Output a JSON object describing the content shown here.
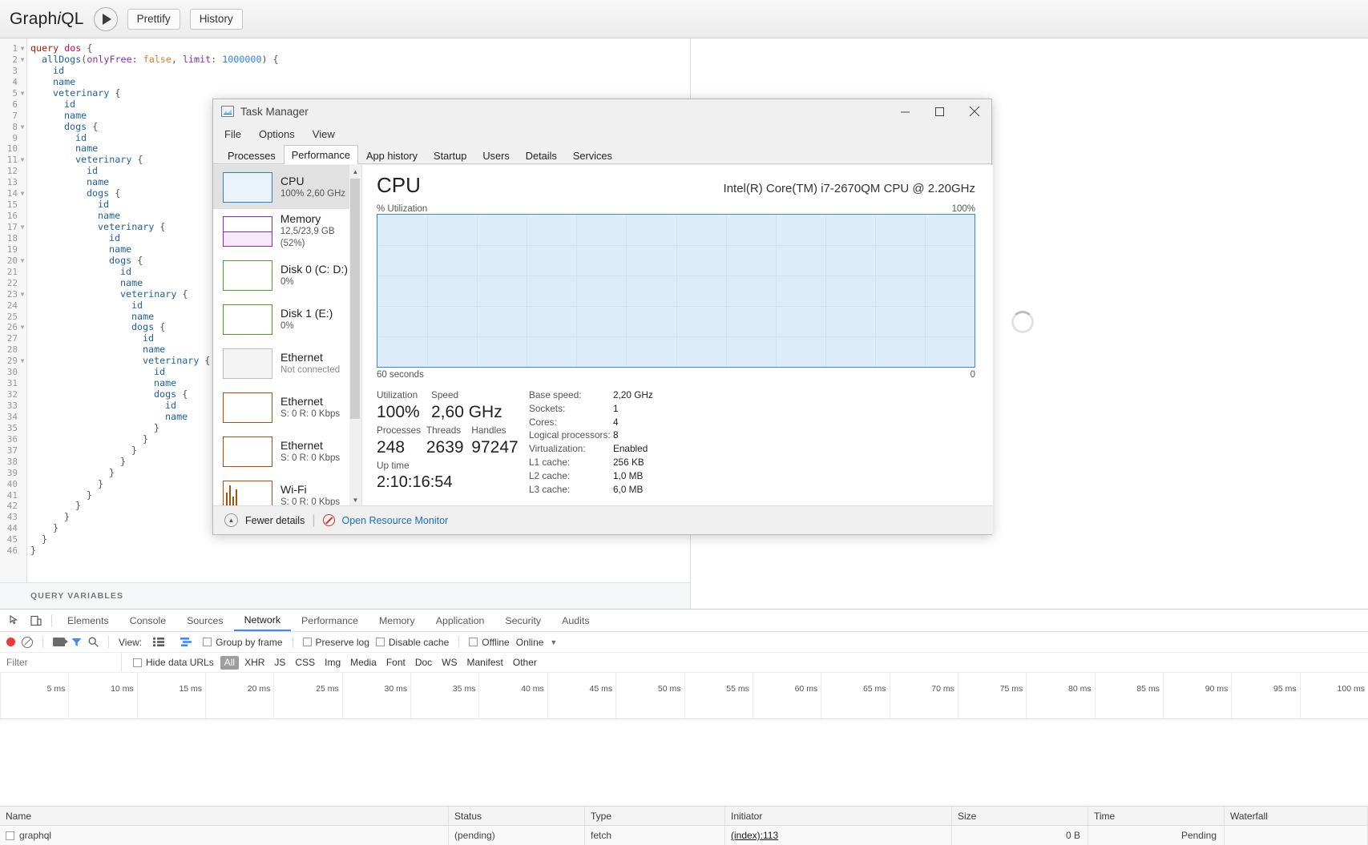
{
  "graphiql": {
    "logo_pre": "Graph",
    "logo_i": "i",
    "logo_post": "QL",
    "execute_label": "▶",
    "prettify_label": "Prettify",
    "history_label": "History",
    "query_variables_label": "QUERY VARIABLES",
    "code_lines": [
      {
        "n": 1,
        "fold": true,
        "indent": 0,
        "tokens": [
          {
            "t": "query ",
            "c": "k-key"
          },
          {
            "t": "dos",
            "c": "k-def"
          },
          {
            "t": " {",
            "c": "k-punc"
          }
        ]
      },
      {
        "n": 2,
        "fold": true,
        "indent": 1,
        "tokens": [
          {
            "t": "allDogs",
            "c": "k-field"
          },
          {
            "t": "(",
            "c": "k-punc"
          },
          {
            "t": "onlyFree",
            "c": "k-arg"
          },
          {
            "t": ": ",
            "c": "k-punc"
          },
          {
            "t": "false",
            "c": "k-bool"
          },
          {
            "t": ", ",
            "c": "k-punc"
          },
          {
            "t": "limit",
            "c": "k-arg"
          },
          {
            "t": ": ",
            "c": "k-punc"
          },
          {
            "t": "1000000",
            "c": "k-num"
          },
          {
            "t": ") {",
            "c": "k-punc"
          }
        ]
      },
      {
        "n": 3,
        "fold": false,
        "indent": 2,
        "tokens": [
          {
            "t": "id",
            "c": "k-field"
          }
        ]
      },
      {
        "n": 4,
        "fold": false,
        "indent": 2,
        "tokens": [
          {
            "t": "name",
            "c": "k-field"
          }
        ]
      },
      {
        "n": 5,
        "fold": true,
        "indent": 2,
        "tokens": [
          {
            "t": "veterinary",
            "c": "k-field"
          },
          {
            "t": " {",
            "c": "k-punc"
          }
        ]
      },
      {
        "n": 6,
        "fold": false,
        "indent": 3,
        "tokens": [
          {
            "t": "id",
            "c": "k-field"
          }
        ]
      },
      {
        "n": 7,
        "fold": false,
        "indent": 3,
        "tokens": [
          {
            "t": "name",
            "c": "k-field"
          }
        ]
      },
      {
        "n": 8,
        "fold": true,
        "indent": 3,
        "tokens": [
          {
            "t": "dogs",
            "c": "k-field"
          },
          {
            "t": " {",
            "c": "k-punc"
          }
        ]
      },
      {
        "n": 9,
        "fold": false,
        "indent": 4,
        "tokens": [
          {
            "t": "id",
            "c": "k-field"
          }
        ]
      },
      {
        "n": 10,
        "fold": false,
        "indent": 4,
        "tokens": [
          {
            "t": "name",
            "c": "k-field"
          }
        ]
      },
      {
        "n": 11,
        "fold": true,
        "indent": 4,
        "tokens": [
          {
            "t": "veterinary",
            "c": "k-field"
          },
          {
            "t": " {",
            "c": "k-punc"
          }
        ]
      },
      {
        "n": 12,
        "fold": false,
        "indent": 5,
        "tokens": [
          {
            "t": "id",
            "c": "k-field"
          }
        ]
      },
      {
        "n": 13,
        "fold": false,
        "indent": 5,
        "tokens": [
          {
            "t": "name",
            "c": "k-field"
          }
        ]
      },
      {
        "n": 14,
        "fold": true,
        "indent": 5,
        "tokens": [
          {
            "t": "dogs",
            "c": "k-field"
          },
          {
            "t": " {",
            "c": "k-punc"
          }
        ]
      },
      {
        "n": 15,
        "fold": false,
        "indent": 6,
        "tokens": [
          {
            "t": "id",
            "c": "k-field"
          }
        ]
      },
      {
        "n": 16,
        "fold": false,
        "indent": 6,
        "tokens": [
          {
            "t": "name",
            "c": "k-field"
          }
        ]
      },
      {
        "n": 17,
        "fold": true,
        "indent": 6,
        "tokens": [
          {
            "t": "veterinary",
            "c": "k-field"
          },
          {
            "t": " {",
            "c": "k-punc"
          }
        ]
      },
      {
        "n": 18,
        "fold": false,
        "indent": 7,
        "tokens": [
          {
            "t": "id",
            "c": "k-field"
          }
        ]
      },
      {
        "n": 19,
        "fold": false,
        "indent": 7,
        "tokens": [
          {
            "t": "name",
            "c": "k-field"
          }
        ]
      },
      {
        "n": 20,
        "fold": true,
        "indent": 7,
        "tokens": [
          {
            "t": "dogs",
            "c": "k-field"
          },
          {
            "t": " {",
            "c": "k-punc"
          }
        ]
      },
      {
        "n": 21,
        "fold": false,
        "indent": 8,
        "tokens": [
          {
            "t": "id",
            "c": "k-field"
          }
        ]
      },
      {
        "n": 22,
        "fold": false,
        "indent": 8,
        "tokens": [
          {
            "t": "name",
            "c": "k-field"
          }
        ]
      },
      {
        "n": 23,
        "fold": true,
        "indent": 8,
        "tokens": [
          {
            "t": "veterinary",
            "c": "k-field"
          },
          {
            "t": " {",
            "c": "k-punc"
          }
        ]
      },
      {
        "n": 24,
        "fold": false,
        "indent": 9,
        "tokens": [
          {
            "t": "id",
            "c": "k-field"
          }
        ]
      },
      {
        "n": 25,
        "fold": false,
        "indent": 9,
        "tokens": [
          {
            "t": "name",
            "c": "k-field"
          }
        ]
      },
      {
        "n": 26,
        "fold": true,
        "indent": 9,
        "tokens": [
          {
            "t": "dogs",
            "c": "k-field"
          },
          {
            "t": " {",
            "c": "k-punc"
          }
        ]
      },
      {
        "n": 27,
        "fold": false,
        "indent": 10,
        "tokens": [
          {
            "t": "id",
            "c": "k-field"
          }
        ]
      },
      {
        "n": 28,
        "fold": false,
        "indent": 10,
        "tokens": [
          {
            "t": "name",
            "c": "k-field"
          }
        ]
      },
      {
        "n": 29,
        "fold": true,
        "indent": 10,
        "tokens": [
          {
            "t": "veterinary",
            "c": "k-field"
          },
          {
            "t": " {",
            "c": "k-punc"
          }
        ]
      },
      {
        "n": 30,
        "fold": false,
        "indent": 11,
        "tokens": [
          {
            "t": "id",
            "c": "k-field"
          }
        ]
      },
      {
        "n": 31,
        "fold": false,
        "indent": 11,
        "tokens": [
          {
            "t": "name",
            "c": "k-field"
          }
        ]
      },
      {
        "n": 32,
        "fold": false,
        "indent": 11,
        "tokens": [
          {
            "t": "dogs",
            "c": "k-field"
          },
          {
            "t": " {",
            "c": "k-punc"
          }
        ]
      },
      {
        "n": 33,
        "fold": false,
        "indent": 12,
        "tokens": [
          {
            "t": "id",
            "c": "k-field"
          }
        ]
      },
      {
        "n": 34,
        "fold": false,
        "indent": 12,
        "tokens": [
          {
            "t": "name",
            "c": "k-field"
          }
        ]
      },
      {
        "n": 35,
        "fold": false,
        "indent": 11,
        "tokens": [
          {
            "t": "}",
            "c": "k-punc"
          }
        ]
      },
      {
        "n": 36,
        "fold": false,
        "indent": 10,
        "tokens": [
          {
            "t": "}",
            "c": "k-punc"
          }
        ]
      },
      {
        "n": 37,
        "fold": false,
        "indent": 9,
        "tokens": [
          {
            "t": "}",
            "c": "k-punc"
          }
        ]
      },
      {
        "n": 38,
        "fold": false,
        "indent": 8,
        "tokens": [
          {
            "t": "}",
            "c": "k-punc"
          }
        ]
      },
      {
        "n": 39,
        "fold": false,
        "indent": 7,
        "tokens": [
          {
            "t": "}",
            "c": "k-punc"
          }
        ]
      },
      {
        "n": 40,
        "fold": false,
        "indent": 6,
        "tokens": [
          {
            "t": "}",
            "c": "k-punc"
          }
        ]
      },
      {
        "n": 41,
        "fold": false,
        "indent": 5,
        "tokens": [
          {
            "t": "}",
            "c": "k-punc"
          }
        ]
      },
      {
        "n": 42,
        "fold": false,
        "indent": 4,
        "tokens": [
          {
            "t": "}",
            "c": "k-punc"
          }
        ]
      },
      {
        "n": 43,
        "fold": false,
        "indent": 3,
        "tokens": [
          {
            "t": "}",
            "c": "k-punc"
          }
        ]
      },
      {
        "n": 44,
        "fold": false,
        "indent": 2,
        "tokens": [
          {
            "t": "}",
            "c": "k-punc"
          }
        ]
      },
      {
        "n": 45,
        "fold": false,
        "indent": 1,
        "tokens": [
          {
            "t": "}",
            "c": "k-punc"
          }
        ]
      },
      {
        "n": 46,
        "fold": false,
        "indent": 0,
        "tokens": [
          {
            "t": "}",
            "c": "k-punc"
          }
        ]
      }
    ]
  },
  "task_manager": {
    "title": "Task Manager",
    "menu": [
      "File",
      "Options",
      "View"
    ],
    "window_buttons": {
      "minimize": "minimize-button",
      "maximize": "maximize-button",
      "close": "close-button"
    },
    "tabs": [
      {
        "label": "Processes",
        "selected": false
      },
      {
        "label": "Performance",
        "selected": true
      },
      {
        "label": "App history",
        "selected": false
      },
      {
        "label": "Startup",
        "selected": false
      },
      {
        "label": "Users",
        "selected": false
      },
      {
        "label": "Details",
        "selected": false
      },
      {
        "label": "Services",
        "selected": false
      }
    ],
    "resources": [
      {
        "name": "CPU",
        "sub": "100%  2,60 GHz",
        "color": "#2f7fc1",
        "selected": true,
        "fill": true,
        "dim": false
      },
      {
        "name": "Memory",
        "sub": "12,5/23,9 GB (52%)",
        "color": "#8b2bb9",
        "selected": false,
        "fill": true,
        "dim": false
      },
      {
        "name": "Disk 0 (C: D:)",
        "sub": "0%",
        "color": "#4f9b24",
        "selected": false,
        "fill": false,
        "dim": false
      },
      {
        "name": "Disk 1 (E:)",
        "sub": "0%",
        "color": "#4f9b24",
        "selected": false,
        "fill": false,
        "dim": false
      },
      {
        "name": "Ethernet",
        "sub": "Not connected",
        "color": "#bdbdbd",
        "selected": false,
        "fill": false,
        "dim": true
      },
      {
        "name": "Ethernet",
        "sub": "S: 0 R: 0 Kbps",
        "color": "#a8500f",
        "selected": false,
        "fill": false,
        "dim": false
      },
      {
        "name": "Ethernet",
        "sub": "S: 0 R: 0 Kbps",
        "color": "#a8500f",
        "selected": false,
        "fill": false,
        "dim": false
      },
      {
        "name": "Wi-Fi",
        "sub": "S: 0 R: 0 Kbps",
        "color": "#a8500f",
        "selected": false,
        "fill": false,
        "dim": false
      }
    ],
    "cpu": {
      "heading": "CPU",
      "model": "Intel(R) Core(TM) i7-2670QM CPU @ 2.20GHz",
      "graph_top_left": "% Utilization",
      "graph_top_right": "100%",
      "graph_bottom_left": "60 seconds",
      "graph_bottom_right": "0",
      "stats": [
        {
          "label": "Utilization",
          "value": "100%"
        },
        {
          "label": "Speed",
          "value": "2,60 GHz"
        },
        {
          "label": "Processes",
          "value": "248"
        },
        {
          "label": "Threads",
          "value": "2639"
        },
        {
          "label": "Handles",
          "value": "97247"
        },
        {
          "label": "Up time",
          "value": "2:10:16:54"
        }
      ],
      "details": [
        {
          "key": "Base speed:",
          "value": "2,20 GHz"
        },
        {
          "key": "Sockets:",
          "value": "1"
        },
        {
          "key": "Cores:",
          "value": "4"
        },
        {
          "key": "Logical processors:",
          "value": "8"
        },
        {
          "key": "Virtualization:",
          "value": "Enabled"
        },
        {
          "key": "L1 cache:",
          "value": "256 KB"
        },
        {
          "key": "L2 cache:",
          "value": "1,0 MB"
        },
        {
          "key": "L3 cache:",
          "value": "6,0 MB"
        }
      ]
    },
    "footer": {
      "fewer_details": "Fewer details",
      "open_resource_monitor": "Open Resource Monitor"
    }
  },
  "devtools": {
    "tabs": [
      {
        "label": "Elements",
        "selected": false
      },
      {
        "label": "Console",
        "selected": false
      },
      {
        "label": "Sources",
        "selected": false
      },
      {
        "label": "Network",
        "selected": true
      },
      {
        "label": "Performance",
        "selected": false
      },
      {
        "label": "Memory",
        "selected": false
      },
      {
        "label": "Application",
        "selected": false
      },
      {
        "label": "Security",
        "selected": false
      },
      {
        "label": "Audits",
        "selected": false
      }
    ],
    "toolbar": {
      "view_label": "View:",
      "group_by_frame": "Group by frame",
      "preserve_log": "Preserve log",
      "disable_cache": "Disable cache",
      "offline": "Offline",
      "online": "Online",
      "dropdown_arrow": "▼"
    },
    "filterbar": {
      "filter_placeholder": "Filter",
      "filter_value": "",
      "hide_data_urls": "Hide data URLs",
      "chips": [
        {
          "label": "All",
          "selected": true
        },
        {
          "label": "XHR",
          "selected": false
        },
        {
          "label": "JS",
          "selected": false
        },
        {
          "label": "CSS",
          "selected": false
        },
        {
          "label": "Img",
          "selected": false
        },
        {
          "label": "Media",
          "selected": false
        },
        {
          "label": "Font",
          "selected": false
        },
        {
          "label": "Doc",
          "selected": false
        },
        {
          "label": "WS",
          "selected": false
        },
        {
          "label": "Manifest",
          "selected": false
        },
        {
          "label": "Other",
          "selected": false
        }
      ]
    },
    "timeline_ticks": [
      "5 ms",
      "10 ms",
      "15 ms",
      "20 ms",
      "25 ms",
      "30 ms",
      "35 ms",
      "40 ms",
      "45 ms",
      "50 ms",
      "55 ms",
      "60 ms",
      "65 ms",
      "70 ms",
      "75 ms",
      "80 ms",
      "85 ms",
      "90 ms",
      "95 ms",
      "100 ms"
    ],
    "table": {
      "columns": [
        "Name",
        "Status",
        "Type",
        "Initiator",
        "Size",
        "Time",
        "Waterfall"
      ],
      "rows": [
        {
          "name": "graphql",
          "status": "(pending)",
          "type": "fetch",
          "initiator": "(index):113",
          "size": "0 B",
          "time": "Pending",
          "waterfall": ""
        }
      ]
    }
  }
}
